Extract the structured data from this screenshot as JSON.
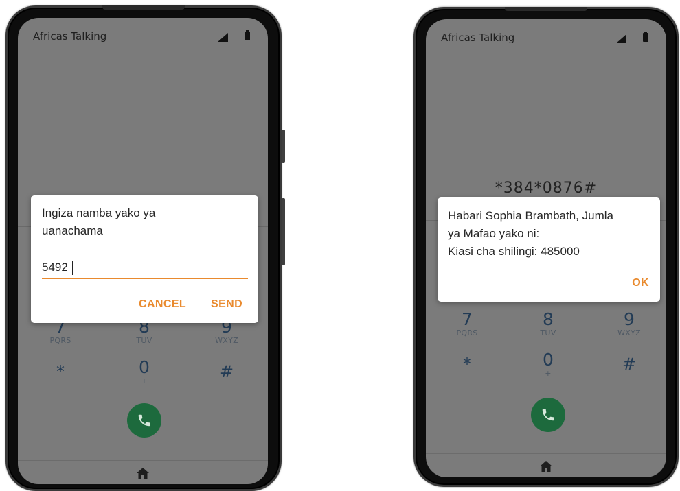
{
  "left_phone": {
    "app_title": "Africas Talking",
    "dialog": {
      "prompt_line1": "Ingiza namba yako ya",
      "prompt_line2": "uanachama",
      "input_value": "5492",
      "cancel_label": "CANCEL",
      "send_label": "SEND"
    },
    "keypad": [
      {
        "digit": "7",
        "letters": "PQRS"
      },
      {
        "digit": "8",
        "letters": "TUV"
      },
      {
        "digit": "9",
        "letters": "WXYZ"
      },
      {
        "digit": "*",
        "letters": ""
      },
      {
        "digit": "0",
        "letters": "+"
      },
      {
        "digit": "#",
        "letters": ""
      }
    ]
  },
  "right_phone": {
    "app_title": "Africas Talking",
    "ussd_code": "*384*0876#",
    "dialog": {
      "line1": "Habari Sophia Brambath, Jumla",
      "line2": "ya Mafao yako ni:",
      "line3": "Kiasi cha shilingi: 485000",
      "ok_label": "OK"
    },
    "keypad": [
      {
        "digit": "7",
        "letters": "PQRS"
      },
      {
        "digit": "8",
        "letters": "TUV"
      },
      {
        "digit": "9",
        "letters": "WXYZ"
      },
      {
        "digit": "*",
        "letters": ""
      },
      {
        "digit": "0",
        "letters": "+"
      },
      {
        "digit": "#",
        "letters": ""
      }
    ]
  },
  "colors": {
    "accent": "#e98a2e",
    "call_button": "#1d6a3d",
    "dimmed_screen": "#7b7b7b",
    "keypad_digit": "#223b55"
  },
  "icons": [
    "signal-icon",
    "battery-icon",
    "phone-icon",
    "home-icon"
  ]
}
